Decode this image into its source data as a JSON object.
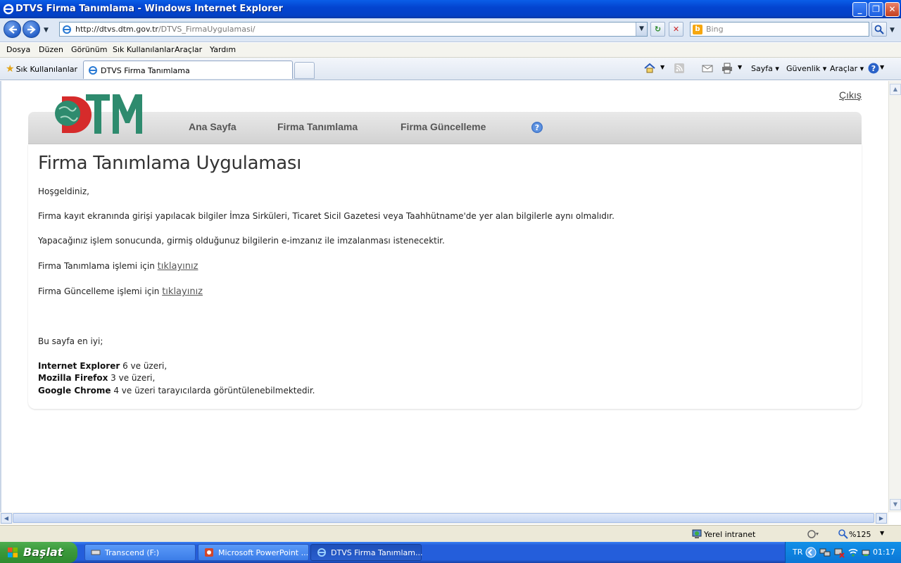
{
  "window": {
    "title": "DTVS Firma Tanımlama - Windows Internet Explorer",
    "min": "_",
    "max": "❐",
    "close": "✕"
  },
  "address": {
    "url_host": "http://dtvs.dtm.gov.tr",
    "url_path": "/DTVS_FirmaUygulamasi/",
    "search_placeholder": "Bing"
  },
  "menu": [
    "Dosya",
    "Düzen",
    "Görünüm",
    "Sık Kullanılanlar",
    "Araçlar",
    "Yardım"
  ],
  "favorites": {
    "label": "Sık Kullanılanlar"
  },
  "tab": {
    "label": "DTVS Firma Tanımlama"
  },
  "commandbar": {
    "page": "Sayfa ▾",
    "security": "Güvenlik ▾",
    "tools": "Araçlar ▾"
  },
  "page": {
    "logout": "Çıkış",
    "nav": [
      "Ana Sayfa",
      "Firma Tanımlama",
      "Firma Güncelleme"
    ],
    "title": "Firma Tanımlama Uygulaması",
    "welcome": "Hoşgeldiniz,",
    "para1": "Firma kayıt ekranında girişi yapılacak bilgiler İmza Sirküleri, Ticaret Sicil Gazetesi veya Taahhütname'de yer alan bilgilerle aynı olmalıdır.",
    "para2": "Yapacağınız işlem sonucunda, girmiş olduğunuz bilgilerin e-imzanız ile imzalanması istenecektir.",
    "define_text": "Firma Tanımlama işlemi için ",
    "update_text": "Firma Güncelleme işlemi için ",
    "link_text": "tıklayınız",
    "best_view": "Bu sayfa en iyi;",
    "browsers": [
      {
        "name": "Internet Explorer",
        "rest": " 6 ve üzeri,"
      },
      {
        "name": "Mozilla Firefox",
        "rest": " 3 ve üzeri,"
      },
      {
        "name": "Google Chrome",
        "rest": " 4 ve üzeri tarayıcılarda görüntülenebilmektedir."
      }
    ]
  },
  "status": {
    "zone": "Yerel intranet",
    "zoom": "%125"
  },
  "taskbar": {
    "start": "Başlat",
    "tasks": [
      "Transcend (F:)",
      "Microsoft PowerPoint ...",
      "DTVS Firma Tanımlam..."
    ],
    "lang": "TR",
    "time": "01:17"
  },
  "colors": {
    "accent_green": "#2e8b6e",
    "logo_red": "#d62b2b"
  }
}
